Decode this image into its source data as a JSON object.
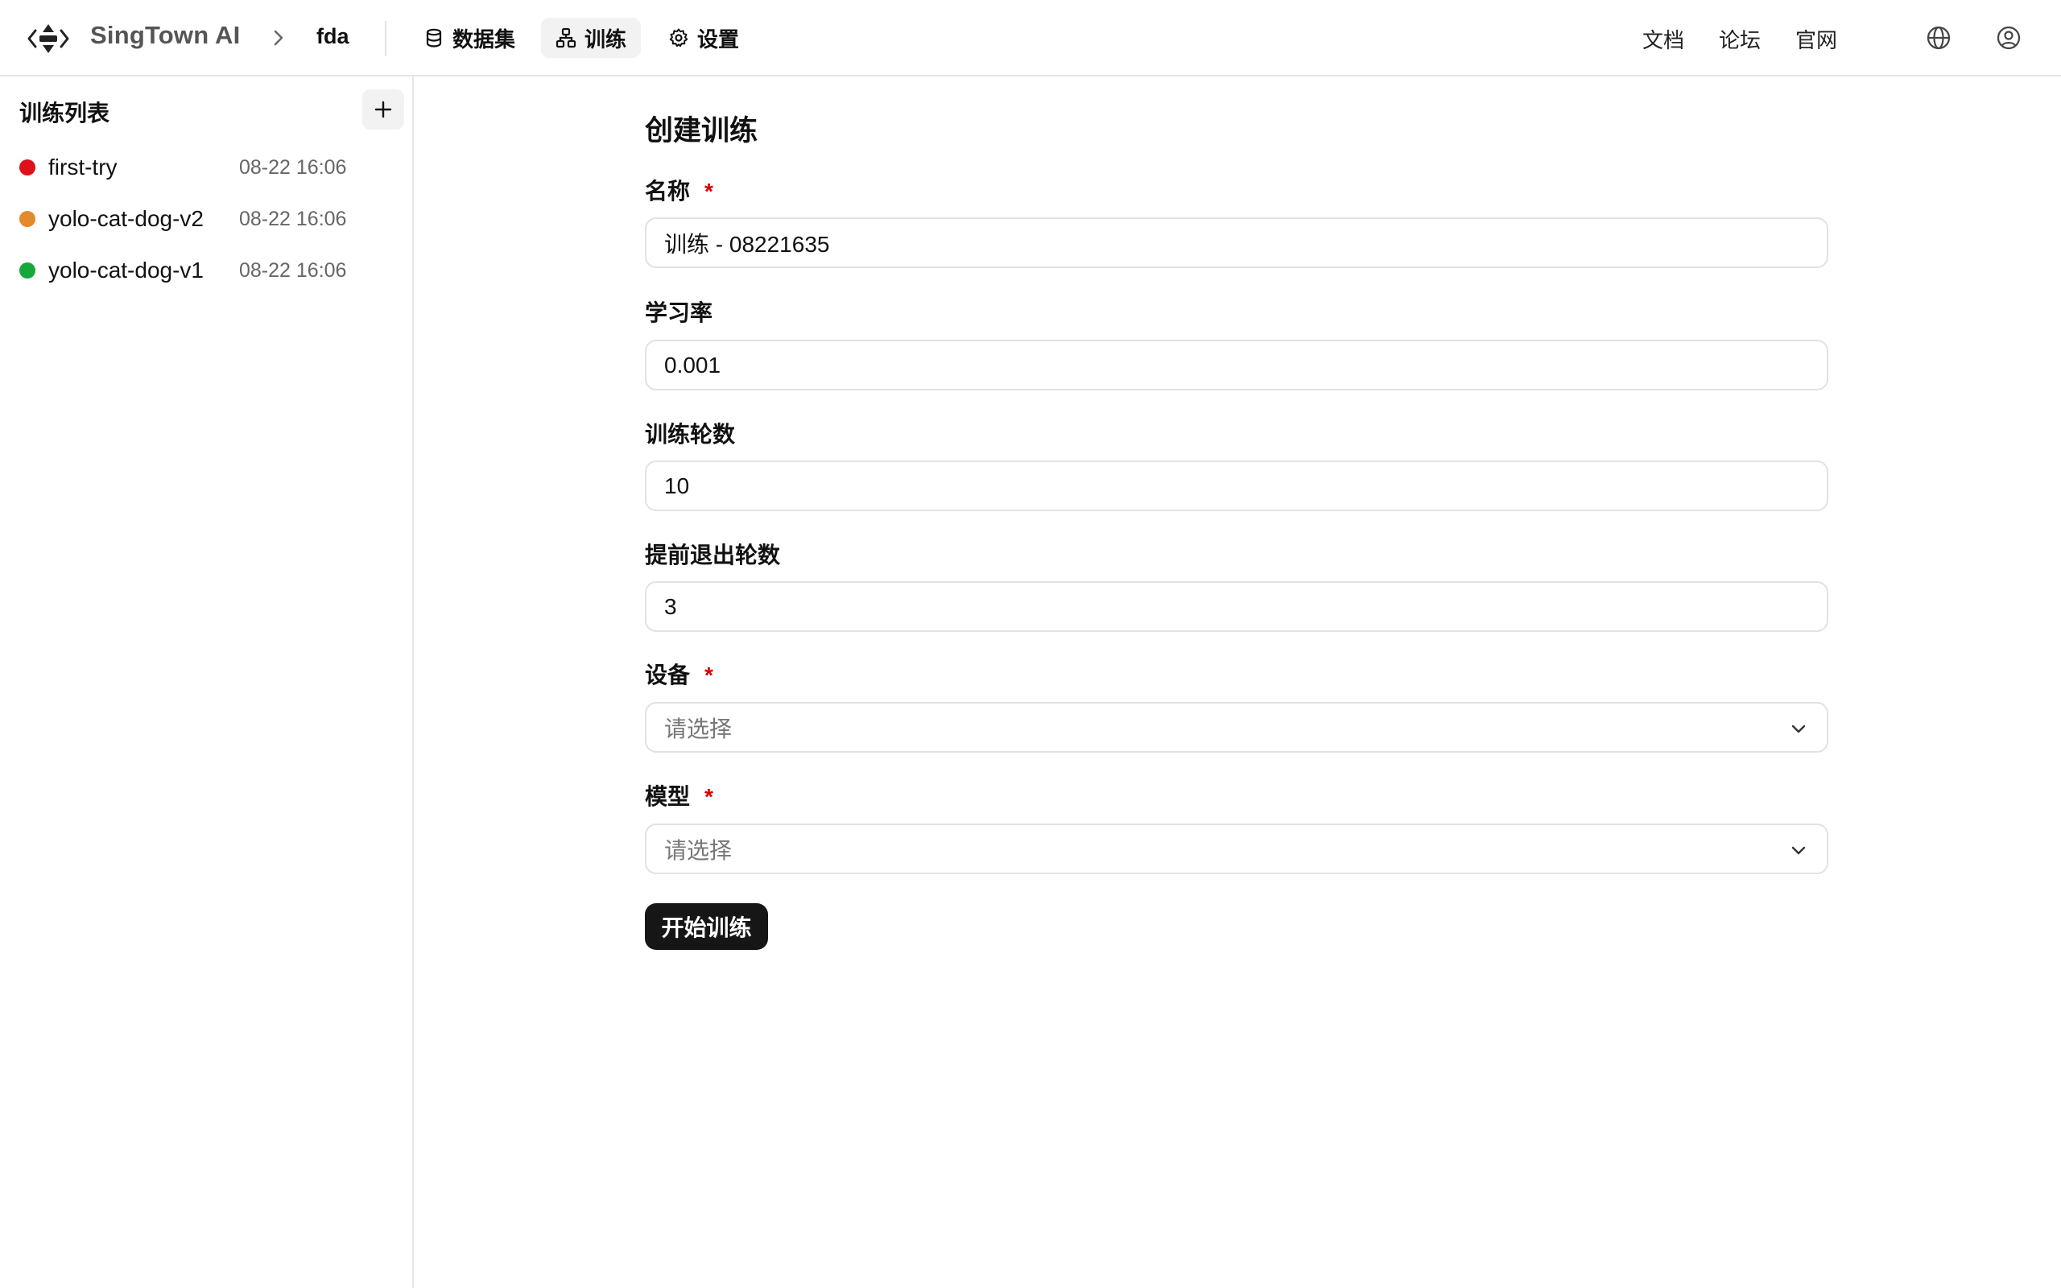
{
  "header": {
    "brand": "SingTown AI",
    "project": "fda",
    "nav": [
      {
        "label": "数据集",
        "icon": "database-icon"
      },
      {
        "label": "训练",
        "icon": "network-icon",
        "active": true
      },
      {
        "label": "设置",
        "icon": "gear-icon"
      }
    ],
    "links": [
      "文档",
      "论坛",
      "官网"
    ]
  },
  "sidebar": {
    "title": "训练列表",
    "runs": [
      {
        "name": "first-try",
        "time": "08-22 16:06",
        "status_color": "#e0101b"
      },
      {
        "name": "yolo-cat-dog-v2",
        "time": "08-22 16:06",
        "status_color": "#e38a2c"
      },
      {
        "name": "yolo-cat-dog-v1",
        "time": "08-22 16:06",
        "status_color": "#16a83a"
      }
    ]
  },
  "form": {
    "title": "创建训练",
    "required_mark": "*",
    "name": {
      "label": "名称",
      "value": "训练 - 08221635"
    },
    "learning_rate": {
      "label": "学习率",
      "value": "0.001"
    },
    "epochs": {
      "label": "训练轮数",
      "value": "10"
    },
    "early_stop": {
      "label": "提前退出轮数",
      "value": "3"
    },
    "device": {
      "label": "设备",
      "placeholder": "请选择"
    },
    "model": {
      "label": "模型",
      "placeholder": "请选择"
    },
    "submit_label": "开始训练"
  }
}
